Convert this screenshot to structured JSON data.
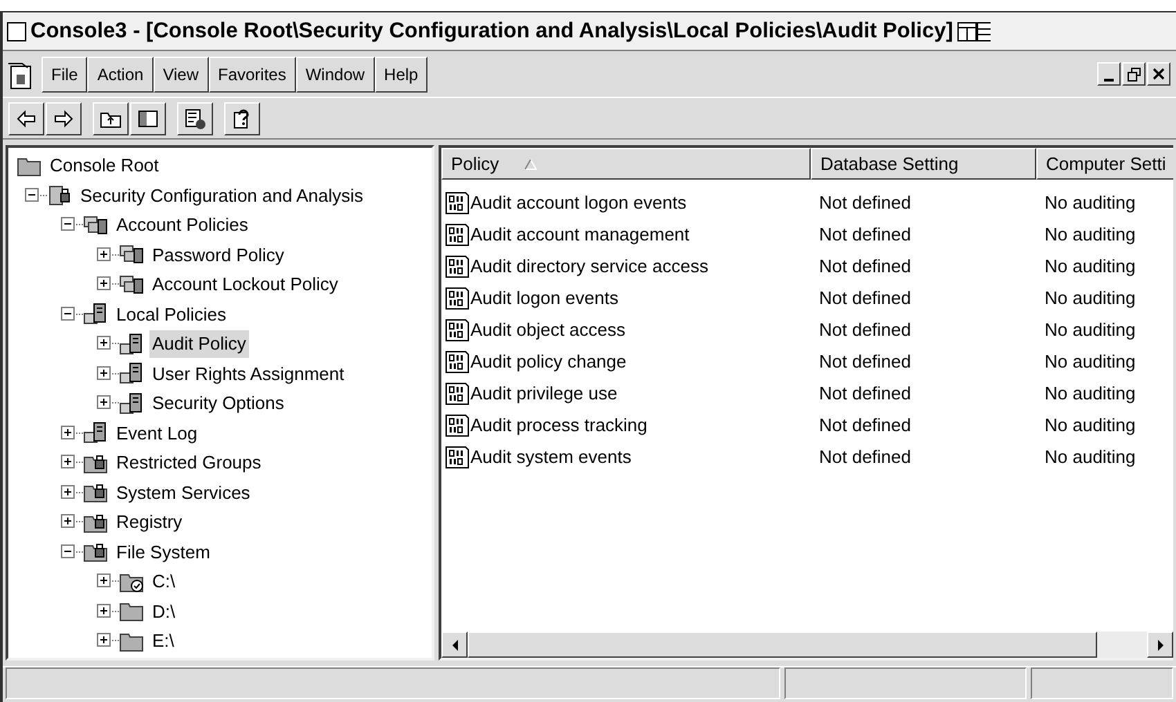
{
  "window": {
    "title": "Console3 - [Console Root\\Security Configuration and Analysis\\Local Policies\\Audit Policy]"
  },
  "menu": [
    {
      "label": "File"
    },
    {
      "label": "Action"
    },
    {
      "label": "View"
    },
    {
      "label": "Favorites"
    },
    {
      "label": "Window"
    },
    {
      "label": "Help"
    }
  ],
  "tree": [
    {
      "label": "Console Root",
      "kind": "folder",
      "selected": false,
      "children": [
        {
          "label": "Security Configuration and Analysis",
          "kind": "security",
          "expanded": true,
          "selected": false,
          "children": [
            {
              "label": "Account Policies",
              "kind": "policy-set",
              "expanded": true,
              "selected": false,
              "children": [
                {
                  "label": "Password Policy",
                  "kind": "policy-set",
                  "expanded": false,
                  "selected": false
                },
                {
                  "label": "Account Lockout Policy",
                  "kind": "policy-set",
                  "expanded": false,
                  "selected": false
                }
              ]
            },
            {
              "label": "Local Policies",
              "kind": "policy",
              "expanded": true,
              "selected": false,
              "children": [
                {
                  "label": "Audit Policy",
                  "kind": "policy",
                  "expanded": false,
                  "selected": true
                },
                {
                  "label": "User Rights Assignment",
                  "kind": "policy",
                  "expanded": false,
                  "selected": false
                },
                {
                  "label": "Security Options",
                  "kind": "policy",
                  "expanded": false,
                  "selected": false
                }
              ]
            },
            {
              "label": "Event Log",
              "kind": "policy",
              "expanded": false,
              "selected": false
            },
            {
              "label": "Restricted Groups",
              "kind": "locked-folder",
              "expanded": false,
              "selected": false
            },
            {
              "label": "System Services",
              "kind": "locked-folder",
              "expanded": false,
              "selected": false
            },
            {
              "label": "Registry",
              "kind": "locked-folder",
              "expanded": false,
              "selected": false
            },
            {
              "label": "File System",
              "kind": "locked-folder",
              "expanded": true,
              "selected": false,
              "children": [
                {
                  "label": "C:\\",
                  "kind": "checked-folder",
                  "expanded": false,
                  "selected": false
                },
                {
                  "label": "D:\\",
                  "kind": "folder",
                  "expanded": false,
                  "selected": false
                },
                {
                  "label": "E:\\",
                  "kind": "folder",
                  "expanded": false,
                  "selected": false
                }
              ]
            }
          ]
        }
      ]
    }
  ],
  "table": {
    "columns": [
      {
        "label": "Policy",
        "sorted": true
      },
      {
        "label": "Database Setting"
      },
      {
        "label": "Computer Setti"
      }
    ],
    "rows": [
      [
        "Audit account logon events",
        "Not defined",
        "No auditing"
      ],
      [
        "Audit account management",
        "Not defined",
        "No auditing"
      ],
      [
        "Audit directory service access",
        "Not defined",
        "No auditing"
      ],
      [
        "Audit logon events",
        "Not defined",
        "No auditing"
      ],
      [
        "Audit object access",
        "Not defined",
        "No auditing"
      ],
      [
        "Audit policy change",
        "Not defined",
        "No auditing"
      ],
      [
        "Audit privilege use",
        "Not defined",
        "No auditing"
      ],
      [
        "Audit process tracking",
        "Not defined",
        "No auditing"
      ],
      [
        "Audit system events",
        "Not defined",
        "No auditing"
      ]
    ]
  }
}
